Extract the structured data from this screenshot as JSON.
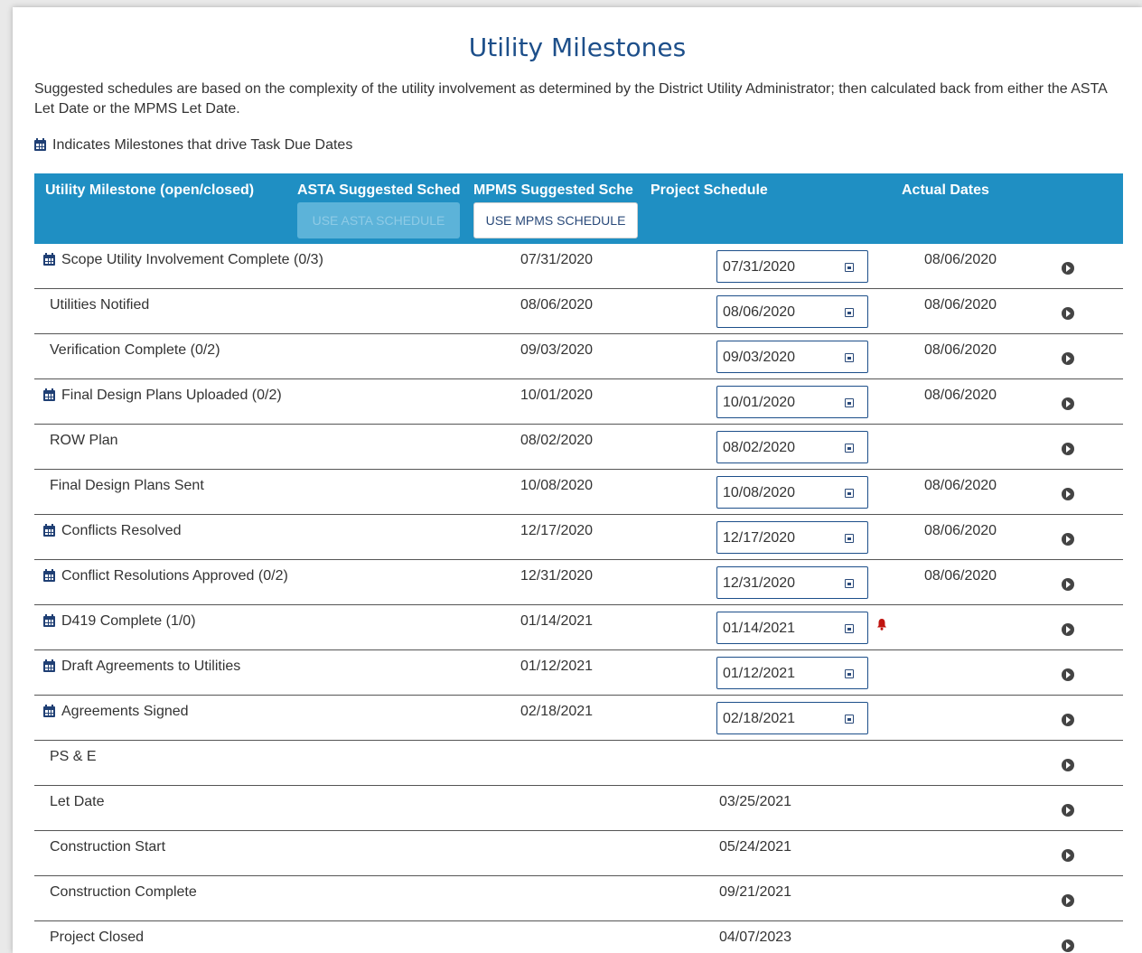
{
  "page": {
    "title": "Utility Milestones",
    "description": "Suggested schedules are based on the complexity of the utility involvement as determined by the District Utility Administrator; then calculated back from either the ASTA Let Date or the MPMS Let Date.",
    "legend_text": "Indicates Milestones that drive Task Due Dates"
  },
  "table": {
    "headers": {
      "milestone": "Utility Milestone (open/closed)",
      "asta": "ASTA Suggested Sched",
      "mpms": "MPMS Suggested Sche",
      "project": "Project Schedule",
      "actual": "Actual Dates"
    },
    "buttons": {
      "asta": "USE ASTA SCHEDULE",
      "mpms": "USE MPMS SCHEDULE"
    },
    "rows": [
      {
        "name": "Scope Utility Involvement Complete (0/3)",
        "drives": true,
        "suggested": "07/31/2020",
        "project": "07/31/2020",
        "editable": true,
        "actual": "08/06/2020",
        "alert": false
      },
      {
        "name": "Utilities Notified",
        "drives": false,
        "suggested": "08/06/2020",
        "project": "08/06/2020",
        "editable": true,
        "actual": "08/06/2020",
        "alert": false
      },
      {
        "name": "Verification Complete (0/2)",
        "drives": false,
        "suggested": "09/03/2020",
        "project": "09/03/2020",
        "editable": true,
        "actual": "08/06/2020",
        "alert": false
      },
      {
        "name": "Final Design Plans Uploaded (0/2)",
        "drives": true,
        "suggested": "10/01/2020",
        "project": "10/01/2020",
        "editable": true,
        "actual": "08/06/2020",
        "alert": false
      },
      {
        "name": "ROW Plan",
        "drives": false,
        "suggested": "08/02/2020",
        "project": "08/02/2020",
        "editable": true,
        "actual": "",
        "alert": false
      },
      {
        "name": "Final Design Plans Sent",
        "drives": false,
        "suggested": "10/08/2020",
        "project": "10/08/2020",
        "editable": true,
        "actual": "08/06/2020",
        "alert": false
      },
      {
        "name": "Conflicts Resolved",
        "drives": true,
        "suggested": "12/17/2020",
        "project": "12/17/2020",
        "editable": true,
        "actual": "08/06/2020",
        "alert": false
      },
      {
        "name": "Conflict Resolutions Approved (0/2)",
        "drives": true,
        "suggested": "12/31/2020",
        "project": "12/31/2020",
        "editable": true,
        "actual": "08/06/2020",
        "alert": false
      },
      {
        "name": "D419 Complete (1/0)",
        "drives": true,
        "suggested": "01/14/2021",
        "project": "01/14/2021",
        "editable": true,
        "actual": "",
        "alert": true
      },
      {
        "name": "Draft Agreements to Utilities",
        "drives": true,
        "suggested": "01/12/2021",
        "project": "01/12/2021",
        "editable": true,
        "actual": "",
        "alert": false
      },
      {
        "name": "Agreements Signed",
        "drives": true,
        "suggested": "02/18/2021",
        "project": "02/18/2021",
        "editable": true,
        "actual": "",
        "alert": false
      },
      {
        "name": "PS & E",
        "drives": false,
        "suggested": "",
        "project": "",
        "editable": false,
        "actual": "",
        "alert": false
      },
      {
        "name": "Let Date",
        "drives": false,
        "suggested": "",
        "project": "03/25/2021",
        "editable": false,
        "actual": "",
        "alert": false
      },
      {
        "name": "Construction Start",
        "drives": false,
        "suggested": "",
        "project": "05/24/2021",
        "editable": false,
        "actual": "",
        "alert": false
      },
      {
        "name": "Construction Complete",
        "drives": false,
        "suggested": "",
        "project": "09/21/2021",
        "editable": false,
        "actual": "",
        "alert": false
      },
      {
        "name": "Project Closed",
        "drives": false,
        "suggested": "",
        "project": "04/07/2023",
        "editable": false,
        "actual": "",
        "alert": false
      }
    ]
  },
  "colors": {
    "header_bg": "#1f8fc3",
    "title": "#1d4f8a",
    "alert": "#c0140f"
  }
}
